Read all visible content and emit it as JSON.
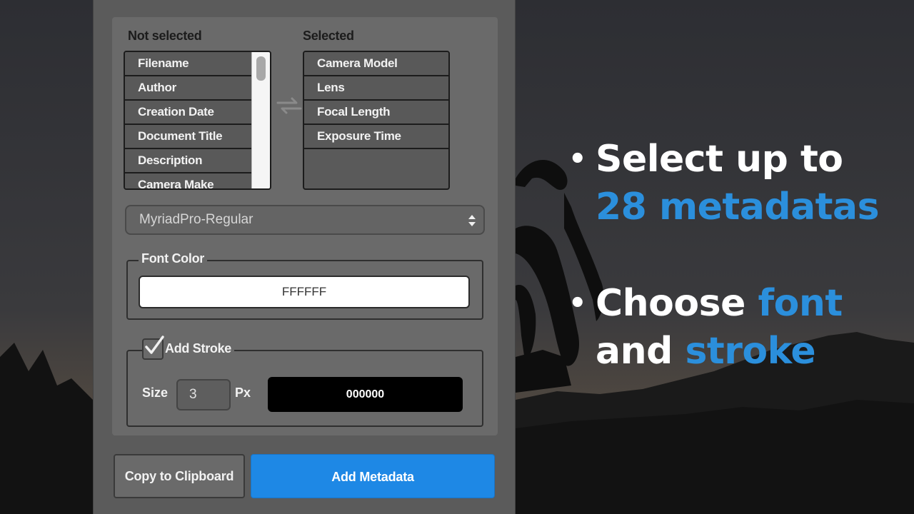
{
  "metadata_picker": {
    "not_selected_label": "Not selected",
    "selected_label": "Selected",
    "not_selected_items": [
      "Filename",
      "Author",
      "Creation Date",
      "Document Title",
      "Description",
      "Camera Make"
    ],
    "selected_items": [
      "Camera Model",
      "Lens",
      "Focal Length",
      "Exposure Time"
    ]
  },
  "font_select": {
    "value": "MyriadPro-Regular"
  },
  "font_color": {
    "legend": "Font Color",
    "value": "FFFFFF"
  },
  "stroke": {
    "legend": "Add Stroke",
    "checked": true,
    "size_label": "Size",
    "size_value": "3",
    "unit_label": "Px",
    "color_value": "000000"
  },
  "buttons": {
    "copy_label": "Copy to Clipboard",
    "add_label": "Add Metadata"
  },
  "bullets": {
    "b1_line1": "Select up to",
    "b1_line2": "28 metadatas",
    "b2_w1": "Choose",
    "b2_w2": "font",
    "b2_w3": "and",
    "b2_w4": "stroke"
  },
  "colors": {
    "accent": "#1e88e5",
    "highlight_text": "#2b8fdc",
    "panel_bg": "#5b5b5b"
  }
}
